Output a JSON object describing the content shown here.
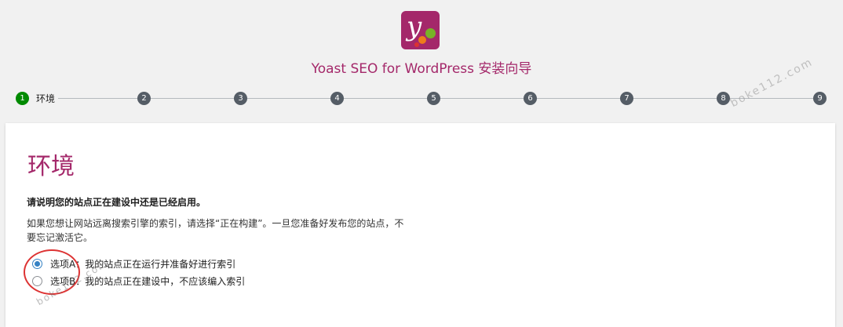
{
  "header": {
    "logo_letter": "y",
    "title": "Yoast SEO for WordPress 安装向导"
  },
  "stepper": {
    "steps": [
      "1",
      "2",
      "3",
      "4",
      "5",
      "6",
      "7",
      "8",
      "9"
    ],
    "active_label": "环境"
  },
  "watermark": "boke112.com",
  "card": {
    "title": "环境",
    "question": "请说明您的站点正在建设中还是已经启用。",
    "description": "如果您想让网站远离搜索引擎的索引，请选择“正在构建”。一旦您准备好发布您的站点，不要忘记激活它。",
    "options": [
      {
        "label": "选项A",
        "text": "我的站点正在运行并准备好进行索引",
        "checked": true
      },
      {
        "label": "选项B",
        "text": "我的站点正在建设中，不应该编入索引",
        "checked": false
      }
    ]
  },
  "colors": {
    "brand": "#a4286a",
    "step_active": "#008a00",
    "step_inactive": "#555d66",
    "radio_accent": "#3582c4"
  }
}
